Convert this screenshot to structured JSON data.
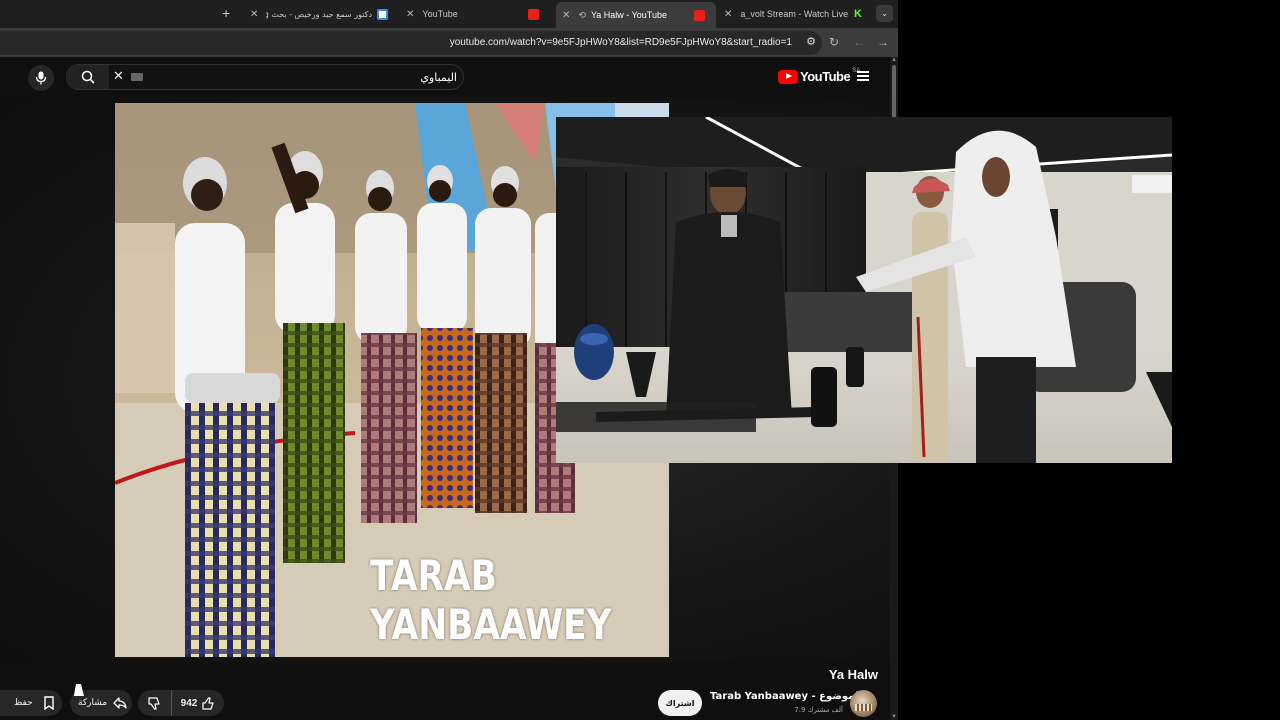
{
  "browser": {
    "tabs": [
      {
        "title": "دكتور سمع جيد ورخيص - بحث Goog",
        "favicon": "google-icon",
        "active": false
      },
      {
        "title": "YouTube",
        "favicon": "youtube-icon",
        "active": false
      },
      {
        "title": "Ya Halw - YouTube",
        "favicon": "youtube-icon",
        "active": true
      },
      {
        "title": "a_volt Stream - Watch Live on K",
        "favicon": "kick-icon",
        "active": false
      }
    ],
    "new_tab_symbol": "+",
    "url": "youtube.com/watch?v=9e5FJpHWoY8&list=RD9e5FJpHWoY8&start_radio=1"
  },
  "youtube": {
    "search_value": "اليمباوي",
    "logo_text": "YouTube",
    "country_code": "SA",
    "video": {
      "watermark": "TARAB YANBAAWEY",
      "title": "Ya Halw"
    },
    "channel": {
      "name": "Tarab Yanbaawey - الموضوع",
      "subscribers": "7.9 ألف مشترك"
    },
    "actions": {
      "subscribe_label": "اشتراك",
      "like_count": "942",
      "share_label": "مشاركة",
      "save_label": "حفظ"
    }
  },
  "colors": {
    "youtube_red": "#ff0000",
    "background": "#0f0f0f",
    "chip": "#272727",
    "kick_green": "#53fc18"
  }
}
